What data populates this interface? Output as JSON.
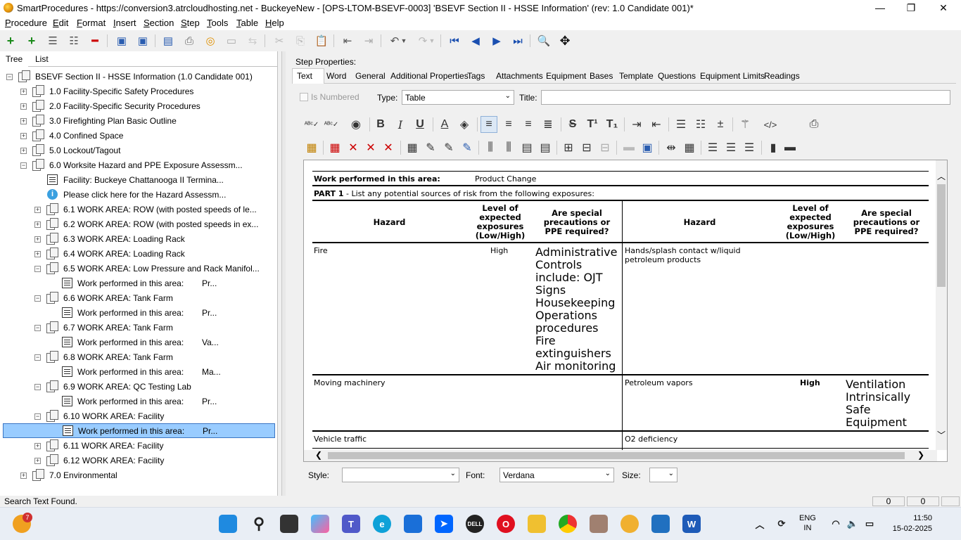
{
  "window": {
    "title": "SmartProcedures - https://conversion3.atrcloudhosting.net - BuckeyeNew - [OPS-LTOM-BSEVF-0003] 'BSEVF Section II - HSSE Information' (rev: 1.0 Candidate 001)*",
    "minimize": "—",
    "maximize": "❐",
    "close": "✕"
  },
  "menu": [
    "Procedure",
    "Edit",
    "Format",
    "Insert",
    "Section",
    "Step",
    "Tools",
    "Table",
    "Help"
  ],
  "left_tabs": [
    "Tree",
    "List"
  ],
  "tree": {
    "root": "BSEVF Section II - HSSE Information (1.0 Candidate 001)",
    "nodes": [
      "1.0 Facility-Specific Safety Procedures",
      "2.0 Facility-Specific Security Procedures",
      "3.0 Firefighting Plan Basic Outline",
      "4.0 Confined Space",
      "5.0 Lockout/Tagout",
      "6.0 Worksite Hazard and PPE Exposure Assessm...",
      "Facility: Buckeye Chattanooga II Termina...",
      "Please click here for the Hazard Assessm...",
      "6.1 WORK AREA: ROW (with posted speeds of le...",
      "6.2 WORK AREA: ROW (with posted speeds in ex...",
      "6.3 WORK AREA: Loading Rack",
      "6.4 WORK AREA: Loading Rack",
      "6.5 WORK AREA: Low Pressure and Rack Manifol...",
      "Work performed in this area:",
      "6.6 WORK AREA: Tank Farm",
      "Work performed in this area:",
      "6.7 WORK AREA: Tank Farm",
      "Work performed in this area:",
      "6.8 WORK AREA: Tank Farm",
      "Work performed in this area:",
      "6.9 WORK AREA: QC Testing Lab",
      "Work performed in this area:",
      "6.10 WORK AREA: Facility",
      "Work performed in this area:",
      "6.11 WORK AREA: Facility",
      "6.12 WORK AREA: Facility",
      "7.0 Environmental"
    ],
    "suffixes": [
      "Pr...",
      "Pr...",
      "Va...",
      "Ma...",
      "Pr...",
      "Pr..."
    ]
  },
  "step_properties": {
    "label": "Step Properties:",
    "tabs": [
      "Text",
      "Word",
      "General",
      "Additional Properties",
      "Tags",
      "Attachments",
      "Equipment",
      "Bases",
      "Template",
      "Questions",
      "Equipment Limits",
      "Readings"
    ],
    "is_numbered": "Is Numbered",
    "type_label": "Type:",
    "type_value": "Table",
    "title_label": "Title:",
    "title_value": ""
  },
  "doc": {
    "work_label": "Work performed in this area:",
    "work_value": "Product Change",
    "part1_bold": "PART 1",
    "part1_rest": " - List any potential sources of risk from the following exposures:",
    "headers": {
      "hazard": "Hazard",
      "level": "Level of expected exposures (Low/High)",
      "special": "Are special precautions or PPE required?"
    },
    "rows": [
      {
        "h1": "Fire",
        "l1": "High",
        "s1": "Administrative Controls include: OJT Signs Housekeeping Operations procedures Fire extinguishers Air monitoring",
        "h2": "Hands/splash contact w/liquid petroleum products",
        "l2": "",
        "s2": ""
      },
      {
        "h1": "Moving machinery",
        "l1": "",
        "s1": "",
        "h2": "Petroleum vapors",
        "l2": "High",
        "s2": "Ventilation Intrinsically Safe Equipment"
      },
      {
        "h1": "Vehicle traffic",
        "l1": "",
        "s1": "",
        "h2": "O2 deficiency",
        "l2": "",
        "s2": ""
      }
    ]
  },
  "bottom": {
    "style_label": "Style:",
    "style_value": "",
    "font_label": "Font:",
    "font_value": "Verdana",
    "size_label": "Size:",
    "size_value": ""
  },
  "status": {
    "text": "Search Text Found.",
    "field1": "0",
    "field2": "0"
  },
  "taskbar": {
    "badge": "7",
    "lang": "ENG",
    "region": "IN",
    "time": "11:50",
    "date": "15-02-2025"
  }
}
